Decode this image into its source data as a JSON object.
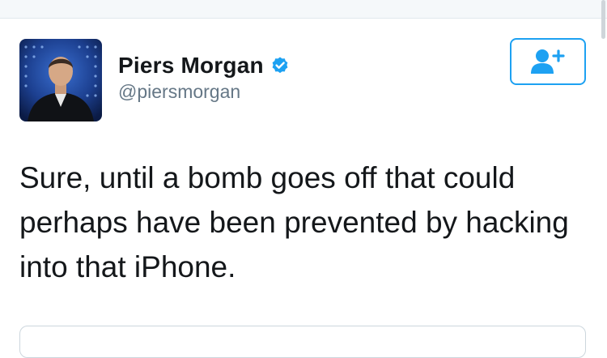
{
  "tweet": {
    "author": {
      "display_name": "Piers Morgan",
      "handle": "@piersmorgan",
      "verified": true,
      "avatar_icon": "profile-photo"
    },
    "follow_button_icon": "add-user-icon",
    "text": "Sure, until a bomb goes off that could perhaps have been prevented by hacking into that iPhone."
  },
  "colors": {
    "accent": "#1da1f2",
    "text": "#14171a",
    "secondary_text": "#657786"
  }
}
